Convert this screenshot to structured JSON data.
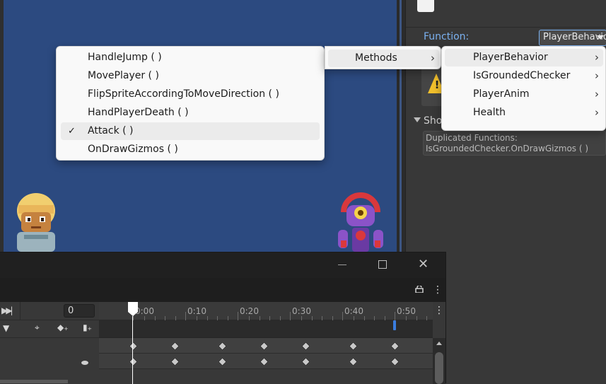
{
  "inspector": {
    "function_label": "Function:",
    "function_value": "PlayerBehavior",
    "show_label": "Sho",
    "duplicated_title": "Duplicated Functions:",
    "duplicated_value": "IsGroundedChecker.OnDrawGizmos ( )"
  },
  "menus": {
    "methods": [
      {
        "label": "HandleJump ( )",
        "checked": false
      },
      {
        "label": "MovePlayer ( )",
        "checked": false
      },
      {
        "label": "FlipSpriteAccordingToMoveDirection ( )",
        "checked": false
      },
      {
        "label": "HandPlayerDeath ( )",
        "checked": false
      },
      {
        "label": "Attack ( )",
        "checked": true
      },
      {
        "label": "OnDrawGizmos ( )",
        "checked": false
      }
    ],
    "category": {
      "label": "Methods"
    },
    "components": [
      {
        "label": "PlayerBehavior",
        "highlighted": true
      },
      {
        "label": "IsGroundedChecker",
        "highlighted": false
      },
      {
        "label": "PlayerAnim",
        "highlighted": false
      },
      {
        "label": "Health",
        "highlighted": false
      }
    ],
    "check_glyph": "✓",
    "chevron_glyph": "›"
  },
  "animation": {
    "frame": "0",
    "time_labels": [
      "0:00",
      "0:10",
      "0:20",
      "0:30",
      "0:40",
      "0:50"
    ],
    "keyframe_times_sec": [
      0,
      8,
      17,
      25,
      33,
      42,
      50
    ],
    "event_time_sec": 50,
    "close_glyph": "✕",
    "more_glyph": "⋮",
    "last_key_glyph": "▶▶|",
    "colors": {
      "event_marker": "#3a7ddf",
      "highlight": "#ebebeb"
    }
  }
}
